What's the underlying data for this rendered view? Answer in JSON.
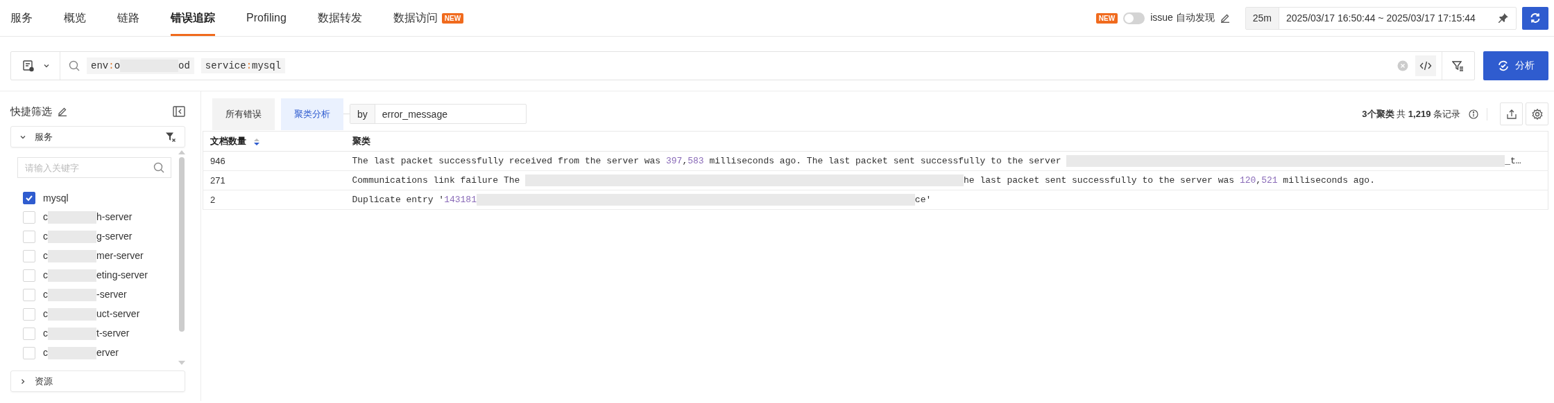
{
  "nav": {
    "tabs": [
      {
        "label": "服务",
        "selected": false
      },
      {
        "label": "概览",
        "selected": false
      },
      {
        "label": "链路",
        "selected": false
      },
      {
        "label": "错误追踪",
        "selected": true
      },
      {
        "label": "Profiling",
        "selected": false
      },
      {
        "label": "数据转发",
        "selected": false
      },
      {
        "label": "数据访问",
        "selected": false,
        "badge": "NEW"
      }
    ]
  },
  "issue_toggle": {
    "badge": "NEW",
    "on": false,
    "label": "issue 自动发现"
  },
  "time_range": {
    "preset": "25m",
    "range": "2025/03/17 16:50:44 ~ 2025/03/17 17:15:44"
  },
  "search": {
    "chips": [
      [
        {
          "kind": "key",
          "text": "env"
        },
        {
          "kind": "colon",
          "text": ":"
        },
        {
          "kind": "text",
          "text": "o"
        },
        {
          "kind": "redacted"
        },
        {
          "kind": "text",
          "text": "od"
        }
      ],
      [
        {
          "kind": "key",
          "text": "service"
        },
        {
          "kind": "colon",
          "text": ":"
        },
        {
          "kind": "text",
          "text": "mysql"
        }
      ]
    ]
  },
  "analyze_button": "分析",
  "quick_filter": {
    "title": "快捷筛选",
    "groups": [
      {
        "label": "服务",
        "expanded": true,
        "placeholder": "请输入关键字",
        "items": [
          {
            "checked": true,
            "label": [
              {
                "kind": "text",
                "text": "mysql"
              }
            ]
          },
          {
            "checked": false,
            "label": [
              {
                "kind": "text",
                "text": "c"
              },
              {
                "kind": "redacted"
              },
              {
                "kind": "text",
                "text": "h-server"
              }
            ]
          },
          {
            "checked": false,
            "label": [
              {
                "kind": "text",
                "text": "c"
              },
              {
                "kind": "redacted"
              },
              {
                "kind": "text",
                "text": "g-server"
              }
            ]
          },
          {
            "checked": false,
            "label": [
              {
                "kind": "text",
                "text": "c"
              },
              {
                "kind": "redacted"
              },
              {
                "kind": "text",
                "text": "mer-server"
              }
            ]
          },
          {
            "checked": false,
            "label": [
              {
                "kind": "text",
                "text": "c"
              },
              {
                "kind": "redacted"
              },
              {
                "kind": "text",
                "text": "eting-server"
              }
            ]
          },
          {
            "checked": false,
            "label": [
              {
                "kind": "text",
                "text": "c"
              },
              {
                "kind": "redacted"
              },
              {
                "kind": "text",
                "text": "-server"
              }
            ]
          },
          {
            "checked": false,
            "label": [
              {
                "kind": "text",
                "text": "c"
              },
              {
                "kind": "redacted"
              },
              {
                "kind": "text",
                "text": "uct-server"
              }
            ]
          },
          {
            "checked": false,
            "label": [
              {
                "kind": "text",
                "text": "c"
              },
              {
                "kind": "redacted"
              },
              {
                "kind": "text",
                "text": "t-server"
              }
            ]
          },
          {
            "checked": false,
            "label": [
              {
                "kind": "text",
                "text": "c"
              },
              {
                "kind": "redacted"
              },
              {
                "kind": "text",
                "text": "erver"
              }
            ]
          }
        ]
      },
      {
        "label": "资源",
        "expanded": false
      }
    ]
  },
  "view_tabs": [
    {
      "label": "所有错误",
      "selected": false
    },
    {
      "label": "聚类分析",
      "selected": true
    }
  ],
  "group_by": {
    "label": "by",
    "value": "error_message"
  },
  "summary": "**3个聚类** 共 **1,219** 条记录",
  "table": {
    "columns": [
      {
        "label": "文档数量",
        "sorted_descending": true
      },
      {
        "label": "聚类"
      }
    ],
    "rows": [
      {
        "count": "946",
        "message": [
          {
            "kind": "text",
            "text": "The last packet successfully received from the server was "
          },
          {
            "kind": "number",
            "text": "397"
          },
          {
            "kind": "text",
            "text": ","
          },
          {
            "kind": "number",
            "text": "583"
          },
          {
            "kind": "text",
            "text": " milliseconds ago. The last packet sent successfully to the server "
          },
          {
            "kind": "redacted"
          },
          {
            "kind": "text",
            "text": "_t…"
          }
        ]
      },
      {
        "count": "271",
        "message": [
          {
            "kind": "text",
            "text": "Communications link failure The "
          },
          {
            "kind": "redacted"
          },
          {
            "kind": "text",
            "text": "he last packet sent successfully to the server was "
          },
          {
            "kind": "number",
            "text": "120"
          },
          {
            "kind": "text",
            "text": ","
          },
          {
            "kind": "number",
            "text": "521"
          },
          {
            "kind": "text",
            "text": " milliseconds ago."
          }
        ]
      },
      {
        "count": "2",
        "message": [
          {
            "kind": "text",
            "text": "Duplicate entry '"
          },
          {
            "kind": "number",
            "text": "143181"
          },
          {
            "kind": "redacted"
          },
          {
            "kind": "text",
            "text": "ce'"
          }
        ]
      }
    ]
  }
}
